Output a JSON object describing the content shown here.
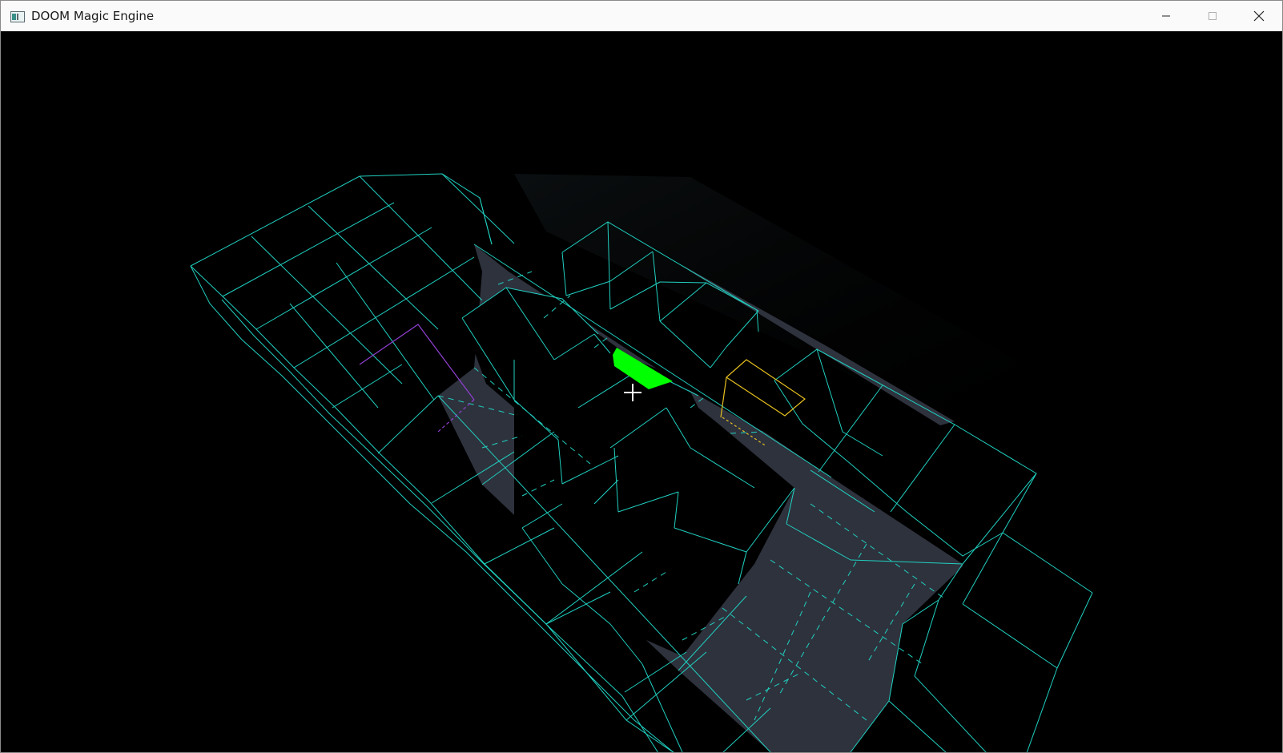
{
  "window": {
    "title": "DOOM Magic Engine",
    "icon": "app-window-icon",
    "controls": {
      "minimize": "minimize-icon",
      "maximize": "maximize-icon",
      "close": "close-icon"
    }
  },
  "viewport": {
    "background": "#000000",
    "wire_color": "#20d0c0",
    "floor_fill": "#2e323d",
    "player_marker_color": "#00ff00",
    "highlight_yellow": "#e8c020",
    "highlight_purple": "#9040d0",
    "crosshair_color": "#ffffff",
    "crosshair": "crosshair-icon"
  }
}
